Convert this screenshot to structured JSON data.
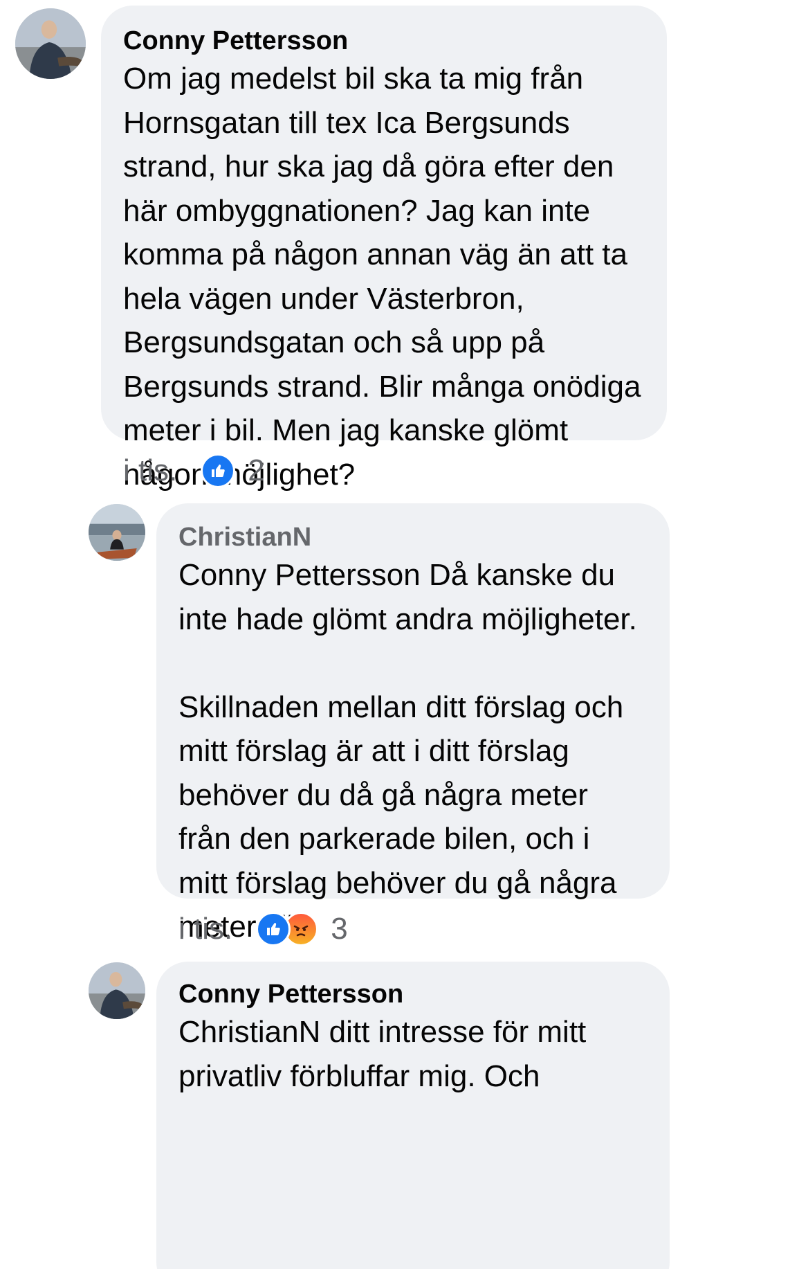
{
  "comments": [
    {
      "author": "Conny Pettersson",
      "text": "Om jag medelst bil ska ta mig från\nHornsgatan till tex Ica Bergsunds\nstrand, hur ska jag då göra efter den\nhär ombyggnationen? Jag kan inte\nkomma på någon annan väg än att ta\nhela vägen under Västerbron,\nBergsundsgatan och så upp på\nBergsunds strand. Blir många onödiga\nmeter i bil. Men jag kanske glömt\nnågon möjlighet?",
      "time": "i tis.",
      "reaction_count": "2",
      "reactions": [
        "like-icon"
      ]
    },
    {
      "author": "ChristianN",
      "mention": "Conny Pettersson",
      "text": " Då kanske du\ninte hade glömt andra möjligheter.\n\nSkillnaden mellan ditt förslag och\nmitt förslag är att i ditt förslag\nbehöver du då gå några meter\nfrån den parkerade bilen, och i\nmitt förslag behöver du gå några\nmeter till.",
      "time": "i tis.",
      "reaction_count": "3",
      "reactions": [
        "like-icon",
        "angry-icon"
      ]
    },
    {
      "author": "Conny Pettersson",
      "mention": "ChristianN",
      "text": " ditt intresse för mitt\nprivatliv förbluffar mig. Och"
    }
  ],
  "colors": {
    "bubble": "#eff1f4",
    "like": "#1877f2",
    "meta_text": "#65676b"
  }
}
